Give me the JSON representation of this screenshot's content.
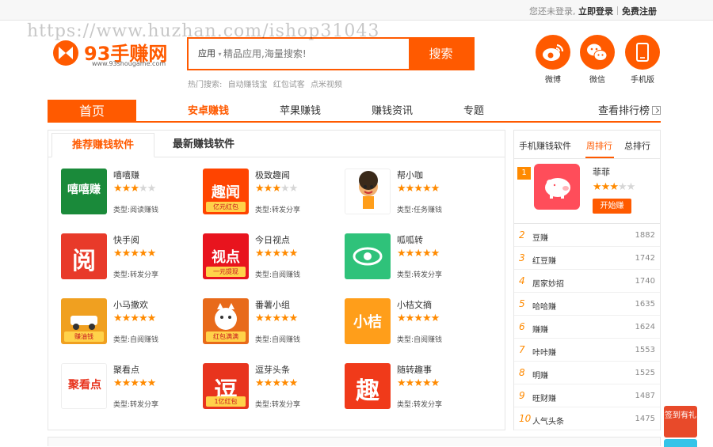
{
  "topbar": {
    "not_logged": "您还未登录,",
    "login": "立即登录",
    "register": "免费注册"
  },
  "watermark": "https://www.huzhan.com/ishop31043",
  "logo": {
    "name": "93手赚网",
    "domain": "www.93shougame.com"
  },
  "search": {
    "category": "应用",
    "placeholder": "精品应用,海量搜索!",
    "button": "搜索"
  },
  "hot": {
    "label": "热门搜索:",
    "items": [
      "自动赚钱宝",
      "红包试客",
      "点米视频"
    ]
  },
  "social": [
    {
      "label": "微博",
      "icon": "weibo-icon"
    },
    {
      "label": "微信",
      "icon": "wechat-icon"
    },
    {
      "label": "手机版",
      "icon": "mobile-icon"
    }
  ],
  "nav": {
    "home": "首页",
    "items": [
      "安卓赚钱",
      "苹果赚钱",
      "赚钱资讯",
      "专题"
    ],
    "rank": "查看排行榜"
  },
  "colors": {
    "accent": "#ff5a00",
    "star": "#ff8a00"
  },
  "main": {
    "tabs": [
      "推荐赚钱软件",
      "最新赚钱软件"
    ],
    "apps": [
      {
        "name": "嘻嘻赚",
        "stars": 3,
        "type": "类型:阅读赚钱",
        "icon_text": "嘻嘻赚",
        "icon_bg": "#1a8a3a"
      },
      {
        "name": "极致趣闻",
        "stars": 3,
        "type": "类型:转发分享",
        "icon_text": "趣闻",
        "icon_sub": "亿元红包",
        "icon_bg": "#ff4400"
      },
      {
        "name": "帮小咖",
        "stars": 5,
        "type": "类型:任务赚钱",
        "icon_text": "",
        "icon_bg": "#ffffff"
      },
      {
        "name": "快手阅",
        "stars": 5,
        "type": "类型:转发分享",
        "icon_text": "阅",
        "icon_bg": "#e83a2a"
      },
      {
        "name": "今日视点",
        "stars": 5,
        "type": "类型:自阅赚钱",
        "icon_text": "视点",
        "icon_sub": "一元提现",
        "icon_bg": "#e8141e"
      },
      {
        "name": "呱呱转",
        "stars": 5,
        "type": "类型:转发分享",
        "icon_text": "",
        "icon_bg": "#2fc27a"
      },
      {
        "name": "小马撒欢",
        "stars": 5,
        "type": "类型:自阅赚钱",
        "icon_text": "",
        "icon_sub": "赚油钱",
        "icon_bg": "#f0a020"
      },
      {
        "name": "番薯小组",
        "stars": 5,
        "type": "类型:自阅赚钱",
        "icon_text": "",
        "icon_sub": "红包满满",
        "icon_bg": "#e86a1a"
      },
      {
        "name": "小桔文摘",
        "stars": 5,
        "type": "类型:自阅赚钱",
        "icon_text": "小桔",
        "icon_bg": "#ff9e1a"
      },
      {
        "name": "聚看点",
        "stars": 5,
        "type": "类型:转发分享",
        "icon_text": "聚看点",
        "icon_bg": "#ffffff"
      },
      {
        "name": "逗芽头条",
        "stars": 5,
        "type": "类型:转发分享",
        "icon_text": "逗",
        "icon_sub": "1亿红包",
        "icon_bg": "#e8341e"
      },
      {
        "name": "随转趣事",
        "stars": 5,
        "type": "类型:转发分享",
        "icon_text": "趣",
        "icon_bg": "#f03a1a"
      }
    ]
  },
  "side": {
    "tabs": [
      "手机赚钱软件",
      "周排行",
      "总排行"
    ],
    "top1": {
      "rank": "1",
      "name": "菲菲",
      "stars": 3,
      "button": "开始赚"
    },
    "rows": [
      {
        "rank": "2",
        "name": "豆赚",
        "count": "1882"
      },
      {
        "rank": "3",
        "name": "红豆赚",
        "count": "1742"
      },
      {
        "rank": "4",
        "name": "居家妙招",
        "count": "1740"
      },
      {
        "rank": "5",
        "name": "哈哈赚",
        "count": "1635"
      },
      {
        "rank": "6",
        "name": "赚赚",
        "count": "1624"
      },
      {
        "rank": "7",
        "name": "咔咔赚",
        "count": "1553"
      },
      {
        "rank": "8",
        "name": "明赚",
        "count": "1525"
      },
      {
        "rank": "9",
        "name": "旺财赚",
        "count": "1487"
      },
      {
        "rank": "10",
        "name": "人气头条",
        "count": "1475"
      }
    ]
  },
  "float": {
    "sign": "签到有礼"
  }
}
